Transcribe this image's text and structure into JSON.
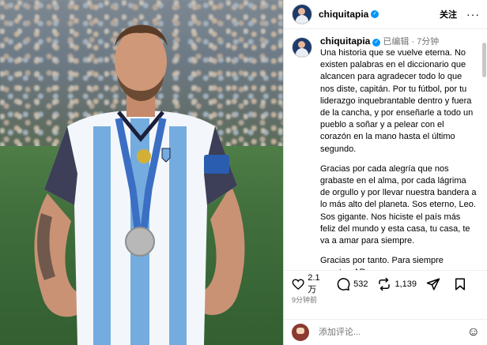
{
  "header": {
    "username": "chiquitapia",
    "follow_label": "关注",
    "more_label": "···"
  },
  "caption": {
    "username": "chiquitapia",
    "edited_label": "已编辑",
    "time": "7分钟",
    "paragraph1": "Una historia que se vuelve eterna. No existen palabras en el diccionario que alcancen para agradecer todo lo que nos diste, capitán. Por tu fútbol, por tu liderazgo inquebrantable dentro y fuera de la cancha, y por enseñarle a todo un pueblo a soñar y a pelear con el corazón en la mano hasta el último segundo.",
    "paragraph2": "Gracias por cada alegría que nos grabaste en el alma, por cada lágrima de orgullo y por llevar nuestra bandera a lo más alto del planeta. Sos eterno, Leo. Sos gigante. Nos hiciste el país más feliz del mundo y esta casa, tu casa, te va a amar para siempre.",
    "paragraph3": "Gracias por tanto. Para siempre nuestro. AR"
  },
  "actions": {
    "likes": "2.1万",
    "comments": "532",
    "reposts": "1,139",
    "posted_ago": "9分钟前"
  },
  "comment_box": {
    "placeholder": "添加评论..."
  },
  "colors": {
    "verified": "#0095f6",
    "muted_text": "#737373"
  }
}
